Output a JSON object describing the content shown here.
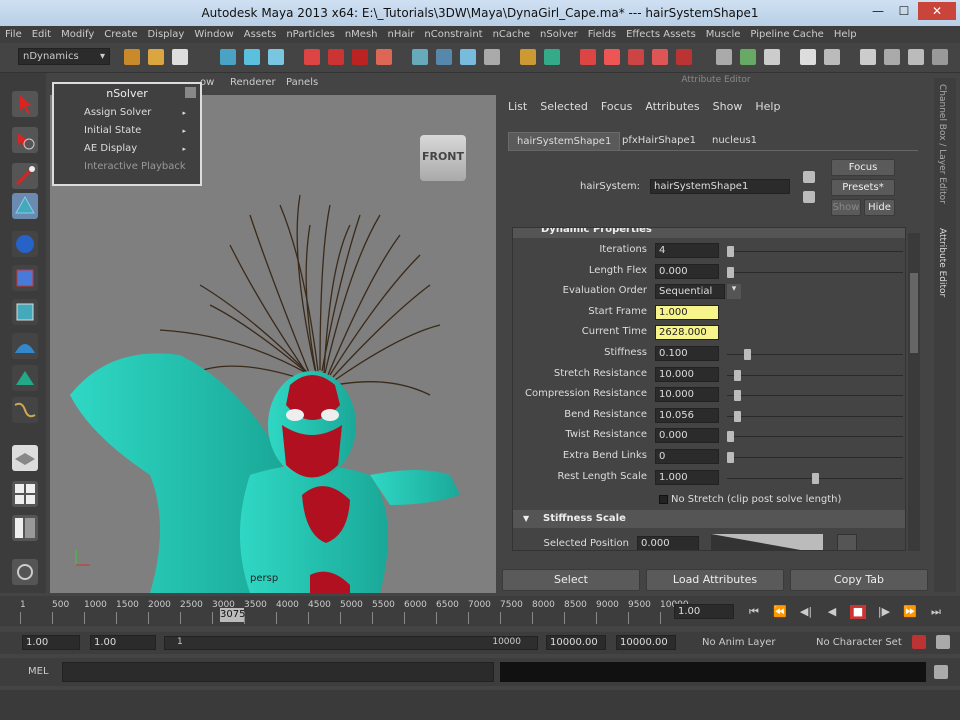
{
  "window": {
    "title": "Autodesk Maya 2013 x64: E:\\_Tutorials\\3DW\\Maya\\DynaGirl_Cape.ma* --- hairSystemShape1",
    "minimize": "—",
    "maximize": "☐",
    "close": "✕"
  },
  "menubar": [
    "File",
    "Edit",
    "Modify",
    "Create",
    "Display",
    "Window",
    "Assets",
    "nParticles",
    "nMesh",
    "nHair",
    "nConstraint",
    "nCache",
    "nSolver",
    "Fields",
    "Effects Assets",
    "Muscle",
    "Pipeline Cache",
    "Help"
  ],
  "shelf": {
    "mode": "nDynamics"
  },
  "viewport": {
    "menu": [
      "ow",
      "Renderer",
      "Panels"
    ],
    "front_cube": "FRONT",
    "camera_label": "persp"
  },
  "nsolver_menu": {
    "title": "nSolver",
    "items": [
      {
        "label": "Assign Solver",
        "arrow": "▸"
      },
      {
        "label": "Initial State",
        "arrow": "▸"
      },
      {
        "label": "AE Display",
        "arrow": "▸"
      },
      {
        "label": "Interactive Playback",
        "arrow": ""
      }
    ]
  },
  "attribute_editor": {
    "title": "Attribute Editor",
    "menu": [
      "List",
      "Selected",
      "Focus",
      "Attributes",
      "Show",
      "Help"
    ],
    "tabs": [
      "hairSystemShape1",
      "pfxHairShape1",
      "nucleus1"
    ],
    "node_label": "hairSystem:",
    "node_value": "hairSystemShape1",
    "focus_btn": "Focus",
    "presets_btn": "Presets*",
    "show_btn": "Show",
    "hide_btn": "Hide",
    "section_header": "Dynamic Properties",
    "rows": [
      {
        "label": "Iterations",
        "value": "4",
        "slider": 0.0
      },
      {
        "label": "Length Flex",
        "value": "0.000",
        "slider": 0.0
      },
      {
        "label": "Evaluation Order",
        "value": "Sequential",
        "dropdown": true
      },
      {
        "label": "Start Frame",
        "value": "1.000",
        "highlight": true
      },
      {
        "label": "Current Time",
        "value": "2628.000",
        "highlight": true
      },
      {
        "label": "Stiffness",
        "value": "0.100",
        "slider": 0.1
      },
      {
        "label": "Stretch Resistance",
        "value": "10.000",
        "slider": 0.04
      },
      {
        "label": "Compression Resistance",
        "value": "10.000",
        "slider": 0.04
      },
      {
        "label": "Bend Resistance",
        "value": "10.056",
        "slider": 0.04
      },
      {
        "label": "Twist Resistance",
        "value": "0.000",
        "slider": 0.0
      },
      {
        "label": "Extra Bend Links",
        "value": "0",
        "slider": 0.0
      },
      {
        "label": "Rest Length Scale",
        "value": "1.000",
        "slider": 0.5
      }
    ],
    "nostretch_label": "No Stretch (clip post solve length)",
    "stiffness_scale": "Stiffness Scale",
    "selected_position_label": "Selected Position",
    "selected_position_value": "0.000",
    "bottom_buttons": [
      "Select",
      "Load Attributes",
      "Copy Tab"
    ]
  },
  "side_tabs": [
    "Channel Box / Layer Editor",
    "Attribute Editor"
  ],
  "timeline": {
    "ticks": [
      "1",
      "500",
      "1000",
      "1500",
      "2000",
      "2500",
      "3000",
      "3500",
      "4000",
      "4500",
      "5000",
      "5500",
      "6000",
      "6500",
      "7000",
      "7500",
      "8000",
      "8500",
      "9000",
      "9500",
      "10000"
    ],
    "current": "3075",
    "current_frame_field": "1.00"
  },
  "range": {
    "start": "1.00",
    "playback_start": "1.00",
    "range_start": "1",
    "range_end": "10000",
    "playback_end": "10000.00",
    "end": "10000.00",
    "anim_layer": "No Anim Layer",
    "character_set": "No Character Set"
  },
  "mel": {
    "label": "MEL"
  },
  "colors": {
    "ui_bg": "#444444",
    "highlight_field": "#f7f48b",
    "viewport": "#7f7f7f",
    "skin": "#35e0c8",
    "mask": "#b01020"
  }
}
